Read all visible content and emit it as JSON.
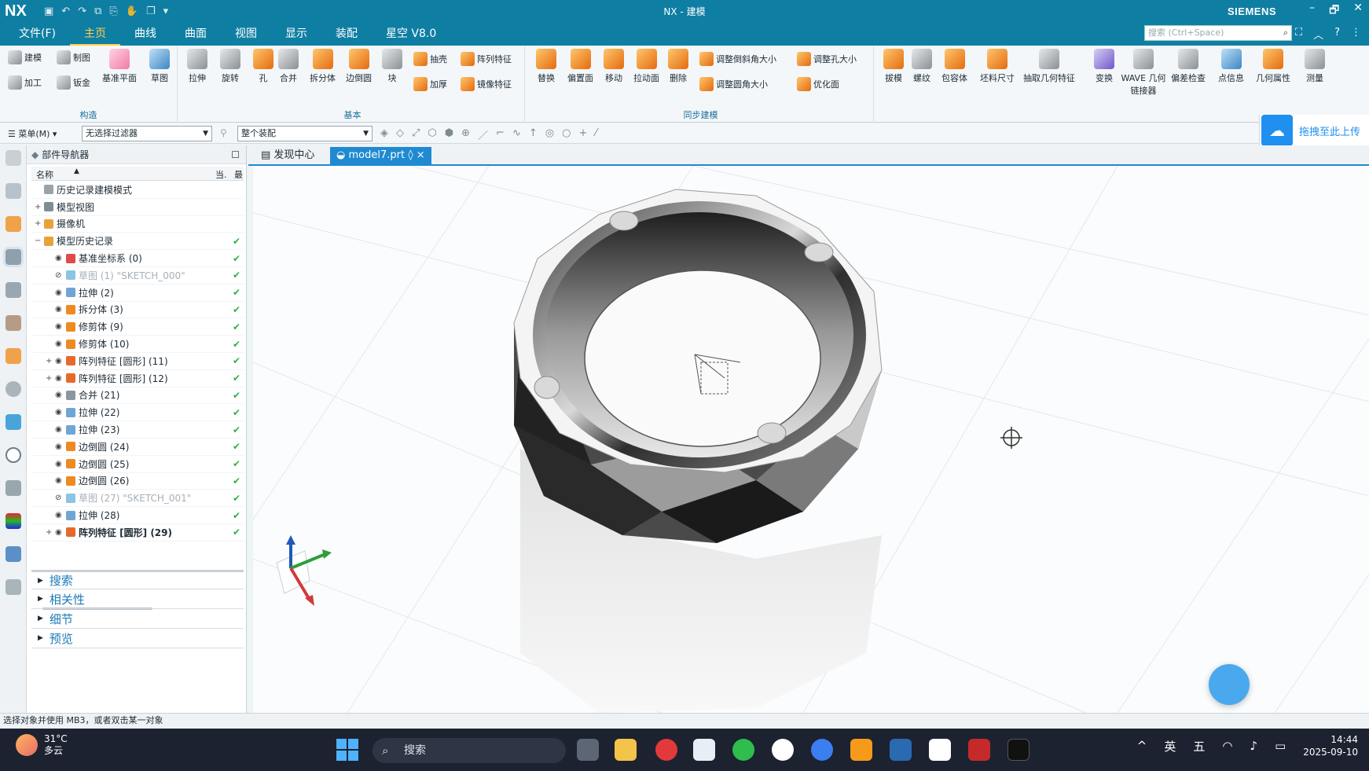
{
  "app": {
    "logo": "NX",
    "window_title": "NX - 建模",
    "brand": "SIEMENS",
    "window_controls": [
      "–",
      "🗗",
      "✕"
    ]
  },
  "menu": {
    "tabs": [
      "文件(F)",
      "主页",
      "曲线",
      "曲面",
      "视图",
      "显示",
      "装配",
      "星空 V8.0"
    ],
    "active_tab": "主页",
    "search_placeholder": "搜索 (Ctrl+Space)"
  },
  "ribbon": {
    "groups": {
      "construct": "构造",
      "basic": "基本",
      "sync": "同步建模"
    },
    "construct": {
      "modeling": "建模",
      "drawing": "制图",
      "machining": "加工",
      "sheetmetal": "钣金",
      "datum_plane": "基准平面",
      "sketch": "草图"
    },
    "basic": {
      "extrude": "拉伸",
      "revolve": "旋转",
      "hole": "孔",
      "unite": "合并",
      "split_body": "拆分体",
      "edge_blend": "边倒圆",
      "block": "块",
      "shell": "抽壳",
      "thicken": "加厚",
      "pattern_feature": "阵列特征",
      "mirror_feature": "镜像特征"
    },
    "sync": {
      "replace": "替换",
      "offset_region": "偏置面",
      "move": "移动",
      "pull": "拉动面",
      "delete": "删除",
      "resize_chamfer": "调整倒斜角大小",
      "resize_hole": "调整孔大小",
      "resize_blend": "调整圆角大小",
      "optimize": "优化面"
    },
    "more": [
      "拔模",
      "螺纹",
      "包容体",
      "坯料尺寸",
      "抽取几何特征",
      "变换",
      "WAVE 几何链接器",
      "偏差检查",
      "点信息",
      "几何属性",
      "测量"
    ]
  },
  "toolbar": {
    "menu_label": "菜单(M)",
    "filter_value": "无选择过滤器",
    "scope_value": "整个装配",
    "upload_label": "拖拽至此上传"
  },
  "navigator": {
    "title": "部件导航器",
    "col_name": "名称",
    "col_current": "当.",
    "col_latest": "最",
    "tree": [
      {
        "label": "历史记录建模模式",
        "level": 0,
        "expand": "",
        "icon": "history-icon",
        "color": "#9aa3aa",
        "check": ""
      },
      {
        "label": "模型视图",
        "level": 0,
        "expand": "+",
        "icon": "model-view-icon",
        "color": "#7e8c96",
        "check": ""
      },
      {
        "label": "摄像机",
        "level": 0,
        "expand": "+",
        "icon": "camera-icon",
        "color": "#e8a23a",
        "check": ""
      },
      {
        "label": "模型历史记录",
        "level": 0,
        "expand": "−",
        "icon": "model-history-icon",
        "color": "#e8a23a",
        "check": "✔"
      },
      {
        "label": "基准坐标系 (0)",
        "level": 1,
        "icon": "datum-csys-icon",
        "color": "#e24a4a",
        "check": "✔"
      },
      {
        "label": "草图 (1) \"SKETCH_000\"",
        "level": 1,
        "icon": "sketch-icon",
        "color": "#8ac4e6",
        "check": "✔",
        "dim": true
      },
      {
        "label": "拉伸 (2)",
        "level": 1,
        "icon": "extrude-icon",
        "color": "#6fa6d6",
        "check": "✔"
      },
      {
        "label": "拆分体 (3)",
        "level": 1,
        "icon": "split-body-icon",
        "color": "#ee8a22",
        "check": "✔"
      },
      {
        "label": "修剪体 (9)",
        "level": 1,
        "icon": "trim-body-icon",
        "color": "#ee8a22",
        "check": "✔"
      },
      {
        "label": "修剪体 (10)",
        "level": 1,
        "icon": "trim-body-icon",
        "color": "#ee8a22",
        "check": "✔"
      },
      {
        "label": "阵列特征 [圆形] (11)",
        "level": 1,
        "expand": "+",
        "icon": "pattern-icon",
        "color": "#e86a2a",
        "check": "✔"
      },
      {
        "label": "阵列特征 [圆形] (12)",
        "level": 1,
        "expand": "+",
        "icon": "pattern-icon",
        "color": "#e86a2a",
        "check": "✔"
      },
      {
        "label": "合并 (21)",
        "level": 1,
        "icon": "unite-icon",
        "color": "#8a96a0",
        "check": "✔"
      },
      {
        "label": "拉伸 (22)",
        "level": 1,
        "icon": "extrude-icon",
        "color": "#6fa6d6",
        "check": "✔"
      },
      {
        "label": "拉伸 (23)",
        "level": 1,
        "icon": "extrude-icon",
        "color": "#6fa6d6",
        "check": "✔"
      },
      {
        "label": "边倒圆 (24)",
        "level": 1,
        "icon": "edge-blend-icon",
        "color": "#ee8a22",
        "check": "✔"
      },
      {
        "label": "边倒圆 (25)",
        "level": 1,
        "icon": "edge-blend-icon",
        "color": "#ee8a22",
        "check": "✔"
      },
      {
        "label": "边倒圆 (26)",
        "level": 1,
        "icon": "edge-blend-icon",
        "color": "#ee8a22",
        "check": "✔"
      },
      {
        "label": "草图 (27) \"SKETCH_001\"",
        "level": 1,
        "icon": "sketch-icon",
        "color": "#8ac4e6",
        "check": "✔",
        "dim": true
      },
      {
        "label": "拉伸 (28)",
        "level": 1,
        "icon": "extrude-icon",
        "color": "#6fa6d6",
        "check": "✔"
      },
      {
        "label": "阵列特征 [圆形] (29)",
        "level": 1,
        "expand": "+",
        "icon": "pattern-icon",
        "color": "#e86a2a",
        "check": "✔",
        "bold": true
      }
    ],
    "sections": [
      "搜索",
      "相关性",
      "细节",
      "预览"
    ]
  },
  "doc_tabs": {
    "discovery": "发现中心",
    "model": "model7.prt",
    "model_status": "◊",
    "close": "×"
  },
  "statusbar": {
    "message": "选择对象并使用 MB3，或者双击某一对象"
  },
  "taskbar": {
    "weather_temp": "31°C",
    "weather_desc": "多云",
    "search_placeholder": "搜索",
    "ime_lang": "英",
    "ime_mode": "五",
    "time": "14:44",
    "date": "2025-09-10"
  },
  "colors": {
    "title_bg": "#0f7ea3",
    "accent": "#1f8ad1",
    "active_tab": "#ffd04a",
    "check": "#2fb14a"
  }
}
